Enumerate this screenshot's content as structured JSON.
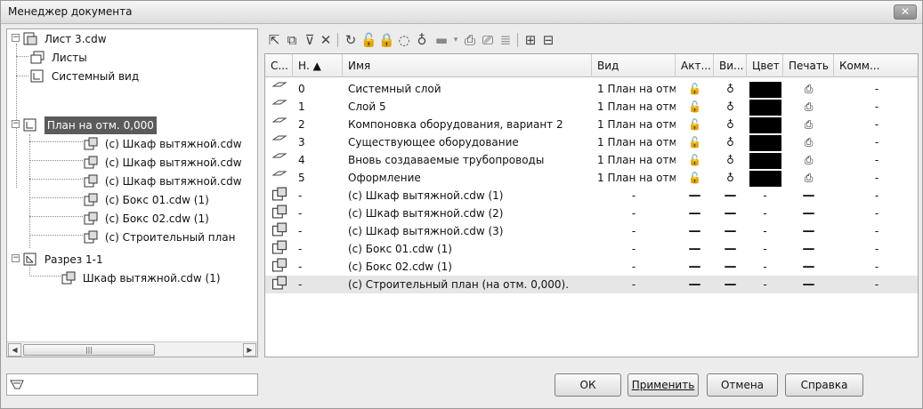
{
  "window": {
    "title": "Менеджер документа",
    "close_label": "✕"
  },
  "tree": {
    "items": [
      {
        "label": "Лист 3.cdw"
      },
      {
        "label": "Листы"
      },
      {
        "label": "Системный вид"
      },
      {
        "label": "План на отм. 0,000"
      },
      {
        "label": "(с) Шкаф вытяжной.cdw"
      },
      {
        "label": "(с) Шкаф вытяжной.cdw"
      },
      {
        "label": "(с) Шкаф вытяжной.cdw"
      },
      {
        "label": "(с) Бокс 01.cdw (1)"
      },
      {
        "label": "(с) Бокс 02.cdw (1)"
      },
      {
        "label": "(с) Строительный план"
      },
      {
        "label": "Разрез 1-1"
      },
      {
        "label": "Шкаф вытяжной.cdw (1)"
      }
    ],
    "scroll_thumb": "|||"
  },
  "grid": {
    "columns": [
      "С...",
      "Н. ▲",
      "Имя",
      "Вид",
      "Акт...",
      "Ви...",
      "Цвет",
      "Печать",
      "Комм..."
    ],
    "rows": [
      {
        "num": "0",
        "name": "Системный слой",
        "view": "1 План на отм",
        "type": "layer-sys",
        "comment": "-"
      },
      {
        "num": "1",
        "name": "Слой 5",
        "view": "1 План на отм",
        "type": "layer",
        "comment": "-"
      },
      {
        "num": "2",
        "name": "Компоновка оборудования, вариант 2",
        "view": "1 План на отм",
        "type": "layer",
        "comment": "-"
      },
      {
        "num": "3",
        "name": "Существующее оборудование",
        "view": "1 План на отм",
        "type": "layer",
        "comment": "-"
      },
      {
        "num": "4",
        "name": "Вновь создаваемые трубопроводы",
        "view": "1 План на отм",
        "type": "layer",
        "comment": "-"
      },
      {
        "num": "5",
        "name": "Оформление",
        "view": "1 План на отм",
        "type": "layer",
        "comment": "-"
      },
      {
        "num": "-",
        "name": "(с) Шкаф вытяжной.cdw (1)",
        "view": "-",
        "type": "frag",
        "comment": "-"
      },
      {
        "num": "-",
        "name": "(с) Шкаф вытяжной.cdw (2)",
        "view": "-",
        "type": "frag",
        "comment": "-"
      },
      {
        "num": "-",
        "name": "(с) Шкаф вытяжной.cdw (3)",
        "view": "-",
        "type": "frag",
        "comment": "-"
      },
      {
        "num": "-",
        "name": "(с) Бокс 01.cdw (1)",
        "view": "-",
        "type": "frag",
        "comment": "-"
      },
      {
        "num": "-",
        "name": "(с) Бокс 02.cdw (1)",
        "view": "-",
        "type": "frag",
        "comment": "-"
      },
      {
        "num": "-",
        "name": "(с) Строительный план (на отм. 0,000).",
        "view": "-",
        "type": "frag",
        "comment": "-"
      }
    ],
    "dash": "-",
    "bold_dash": "—",
    "layer_color": "#000000"
  },
  "buttons": {
    "ok": "ОК",
    "apply": "Применить",
    "cancel": "Отмена",
    "help": "Справка"
  }
}
